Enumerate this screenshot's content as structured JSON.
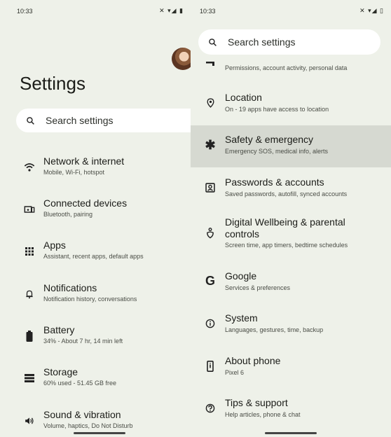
{
  "left": {
    "status": {
      "time": "10:33",
      "icons": "✕ ▾◢ ▮"
    },
    "page_title": "Settings",
    "search_placeholder": "Search settings",
    "items": [
      {
        "title": "Network & internet",
        "subtitle": "Mobile, Wi-Fi, hotspot",
        "icon": "wifi-icon"
      },
      {
        "title": "Connected devices",
        "subtitle": "Bluetooth, pairing",
        "icon": "devices-icon"
      },
      {
        "title": "Apps",
        "subtitle": "Assistant, recent apps, default apps",
        "icon": "apps-grid-icon"
      },
      {
        "title": "Notifications",
        "subtitle": "Notification history, conversations",
        "icon": "bell-icon"
      },
      {
        "title": "Battery",
        "subtitle": "34% - About 7 hr, 14 min left",
        "icon": "battery-icon"
      },
      {
        "title": "Storage",
        "subtitle": "60% used - 51.45 GB free",
        "icon": "storage-icon"
      },
      {
        "title": "Sound & vibration",
        "subtitle": "Volume, haptics, Do Not Disturb",
        "icon": "speaker-icon"
      }
    ]
  },
  "right": {
    "status": {
      "time": "10:33",
      "icons": "✕ ▾◢ ▯"
    },
    "search_placeholder": "Search settings",
    "items": [
      {
        "title": "",
        "subtitle": "Permissions, account activity, personal data",
        "icon": "privacy-icon"
      },
      {
        "title": "Location",
        "subtitle": "On - 19 apps have access to location",
        "icon": "location-pin-icon"
      },
      {
        "title": "Safety & emergency",
        "subtitle": "Emergency SOS, medical info, alerts",
        "icon": "asterisk-icon",
        "highlighted": true
      },
      {
        "title": "Passwords & accounts",
        "subtitle": "Saved passwords, autofill, synced accounts",
        "icon": "account-box-icon"
      },
      {
        "title": "Digital Wellbeing & parental controls",
        "subtitle": "Screen time, app timers, bedtime schedules",
        "icon": "wellbeing-icon"
      },
      {
        "title": "Google",
        "subtitle": "Services & preferences",
        "icon": "google-icon"
      },
      {
        "title": "System",
        "subtitle": "Languages, gestures, time, backup",
        "icon": "info-icon"
      },
      {
        "title": "About phone",
        "subtitle": "Pixel 6",
        "icon": "phone-icon"
      },
      {
        "title": "Tips & support",
        "subtitle": "Help articles, phone & chat",
        "icon": "help-icon"
      }
    ]
  },
  "colors": {
    "background": "#eef1e9",
    "highlight": "#d6d9d1",
    "search_bg": "#ffffff"
  }
}
